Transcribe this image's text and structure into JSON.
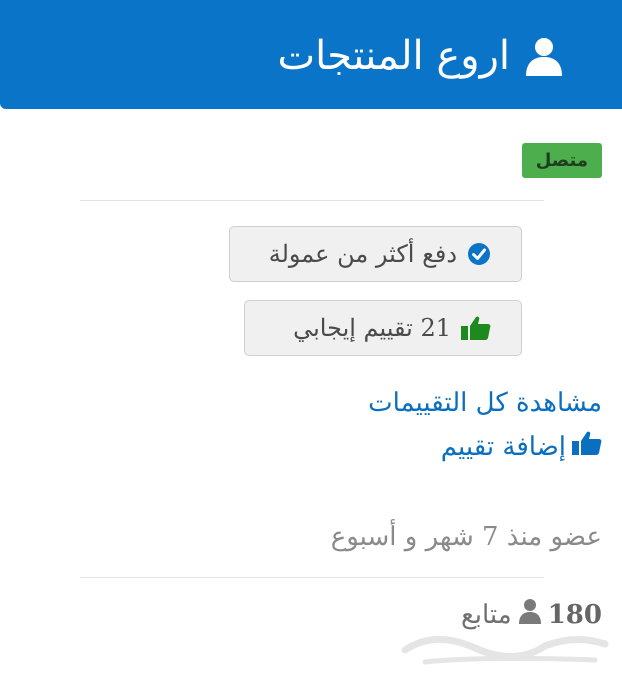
{
  "header": {
    "title": "اروع المنتجات",
    "icon": "user-icon",
    "background": "#0a74c8"
  },
  "status": {
    "label": "متصل",
    "color": "#4cae4c"
  },
  "badges": [
    {
      "icon": "check-circle-icon",
      "label": "دفع أكثر من عمولة",
      "icon_color": "#0a74c8"
    },
    {
      "icon": "thumbs-up-icon",
      "label": "21 تقييم إيجابي",
      "icon_color": "#1e8a1e"
    }
  ],
  "links": {
    "view_all_reviews": "مشاهدة كل التقييمات",
    "add_review": "إضافة تقييم",
    "color": "#0b6fbf"
  },
  "member_since": "عضو منذ 7 شهر و أسبوع",
  "followers": {
    "count": "180",
    "label": "متابع",
    "icon": "user-icon"
  }
}
